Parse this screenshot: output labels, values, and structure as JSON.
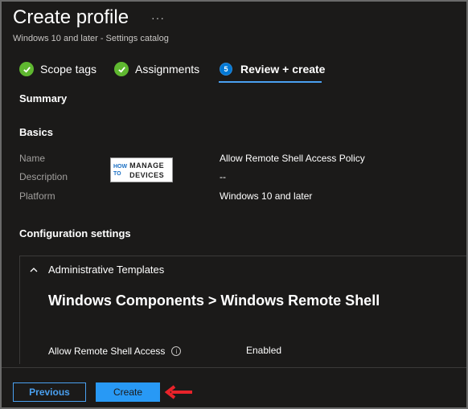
{
  "header": {
    "title": "Create profile",
    "more": "···",
    "subtitle": "Windows 10 and later - Settings catalog"
  },
  "steps": [
    {
      "label": "Scope tags",
      "state": "complete"
    },
    {
      "label": "Assignments",
      "state": "complete"
    },
    {
      "label": "Review + create",
      "state": "current",
      "number": "5"
    }
  ],
  "summary": {
    "heading": "Summary"
  },
  "basics": {
    "heading": "Basics",
    "rows": [
      {
        "label": "Name",
        "value": "Allow Remote Shell Access Policy"
      },
      {
        "label": "Description",
        "value": "--"
      },
      {
        "label": "Platform",
        "value": "Windows 10 and later"
      }
    ]
  },
  "watermark": {
    "left": [
      "HOW",
      "TO"
    ],
    "right": [
      "MANAGE",
      "DEVICES"
    ]
  },
  "config": {
    "heading": "Configuration settings",
    "group": "Administrative Templates",
    "category": "Windows Components > Windows Remote Shell",
    "setting": {
      "name": "Allow Remote Shell Access",
      "value": "Enabled"
    }
  },
  "footer": {
    "previous_label": "Previous",
    "create_label": "Create"
  },
  "colors": {
    "accent": "#2899f5",
    "success": "#5fb830",
    "annotation_arrow": "#e8232a"
  }
}
